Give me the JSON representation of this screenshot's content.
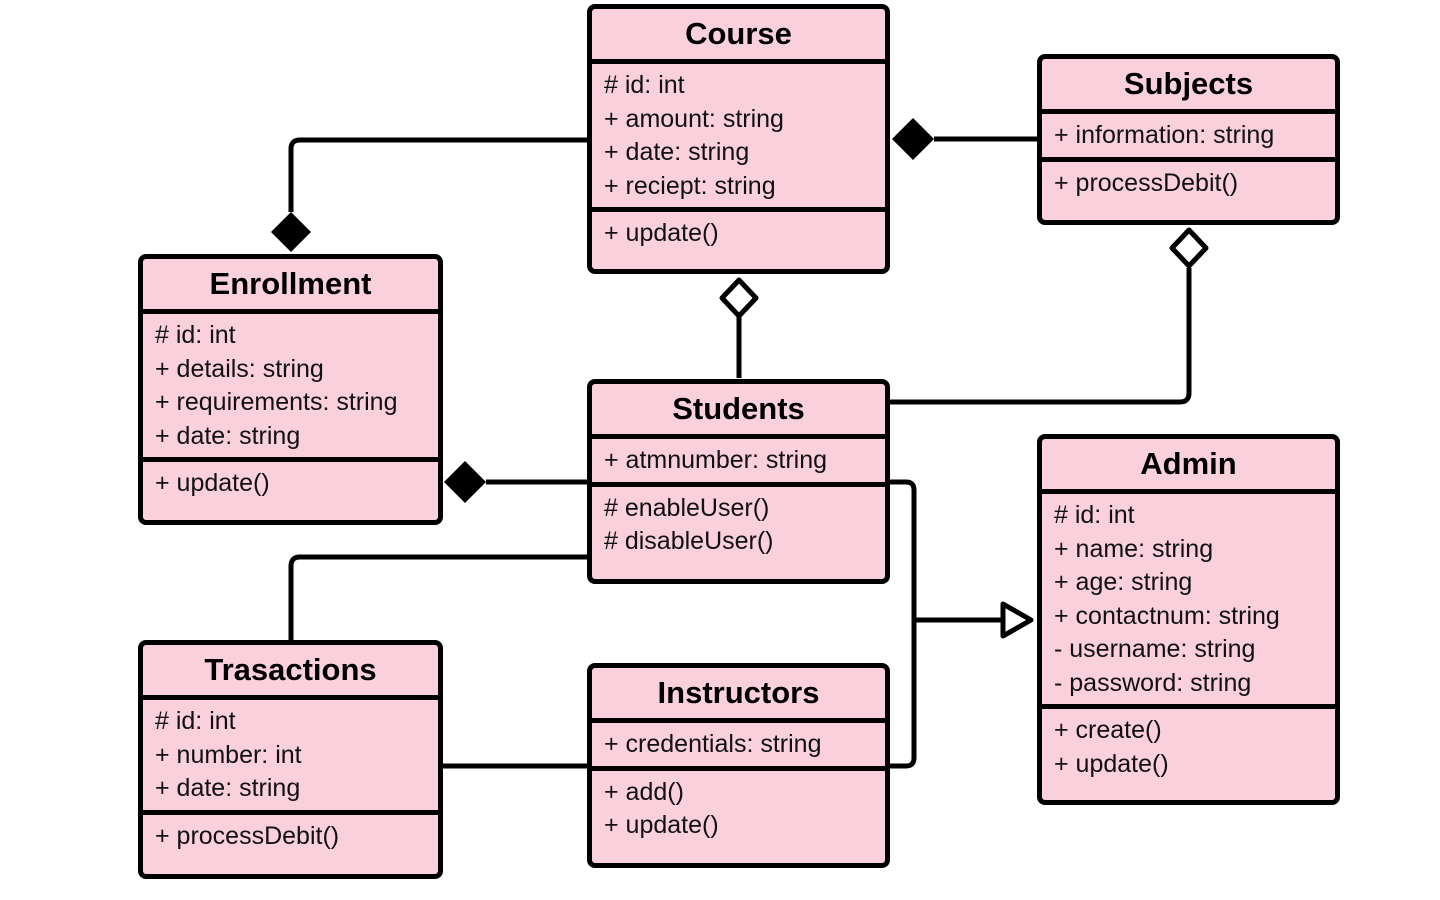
{
  "diagram": {
    "type": "uml-class-diagram",
    "colors": {
      "class_fill": "#f9d0dc",
      "stroke": "#000000",
      "background": "#ffffff"
    },
    "classes": {
      "course": {
        "name": "Course",
        "attributes": [
          "# id: int",
          "+ amount: string",
          "+ date: string",
          "+ reciept: string"
        ],
        "methods": [
          "+ update()"
        ]
      },
      "subjects": {
        "name": "Subjects",
        "attributes": [
          "+ information: string"
        ],
        "methods": [
          "+ processDebit()"
        ]
      },
      "enrollment": {
        "name": "Enrollment",
        "attributes": [
          "# id: int",
          "+ details: string",
          "+ requirements: string",
          "+ date: string"
        ],
        "methods": [
          "+ update()"
        ]
      },
      "students": {
        "name": "Students",
        "attributes": [
          "+ atmnumber: string"
        ],
        "methods": [
          "# enableUser()",
          "# disableUser()"
        ]
      },
      "admin": {
        "name": "Admin",
        "attributes": [
          "# id: int",
          "+ name: string",
          "+ age: string",
          "+ contactnum: string",
          "- username: string",
          "- password: string"
        ],
        "methods": [
          "+ create()",
          "+ update()"
        ]
      },
      "trasactions": {
        "name": "Trasactions",
        "attributes": [
          "# id: int",
          "+ number: int",
          "+ date: string"
        ],
        "methods": [
          "+ processDebit()"
        ]
      },
      "instructors": {
        "name": "Instructors",
        "attributes": [
          "+ credentials: string"
        ],
        "methods": [
          "+ add()",
          "+ update()"
        ]
      }
    },
    "relationships": [
      {
        "from": "Course",
        "to": "Enrollment",
        "type": "composition",
        "marker_at": "Enrollment"
      },
      {
        "from": "Subjects",
        "to": "Course",
        "type": "composition",
        "marker_at": "Course"
      },
      {
        "from": "Students",
        "to": "Course",
        "type": "aggregation",
        "marker_at": "Course"
      },
      {
        "from": "Students",
        "to": "Subjects",
        "type": "aggregation",
        "marker_at": "Subjects"
      },
      {
        "from": "Students",
        "to": "Enrollment",
        "type": "composition",
        "marker_at": "Enrollment"
      },
      {
        "from": "Students",
        "to": "Trasactions",
        "type": "association"
      },
      {
        "from": "Instructors",
        "to": "Trasactions",
        "type": "association"
      },
      {
        "from": "Students",
        "to": "Admin",
        "type": "generalization",
        "marker_at": "Admin"
      },
      {
        "from": "Instructors",
        "to": "Admin",
        "type": "generalization",
        "marker_at": "Admin"
      }
    ]
  }
}
